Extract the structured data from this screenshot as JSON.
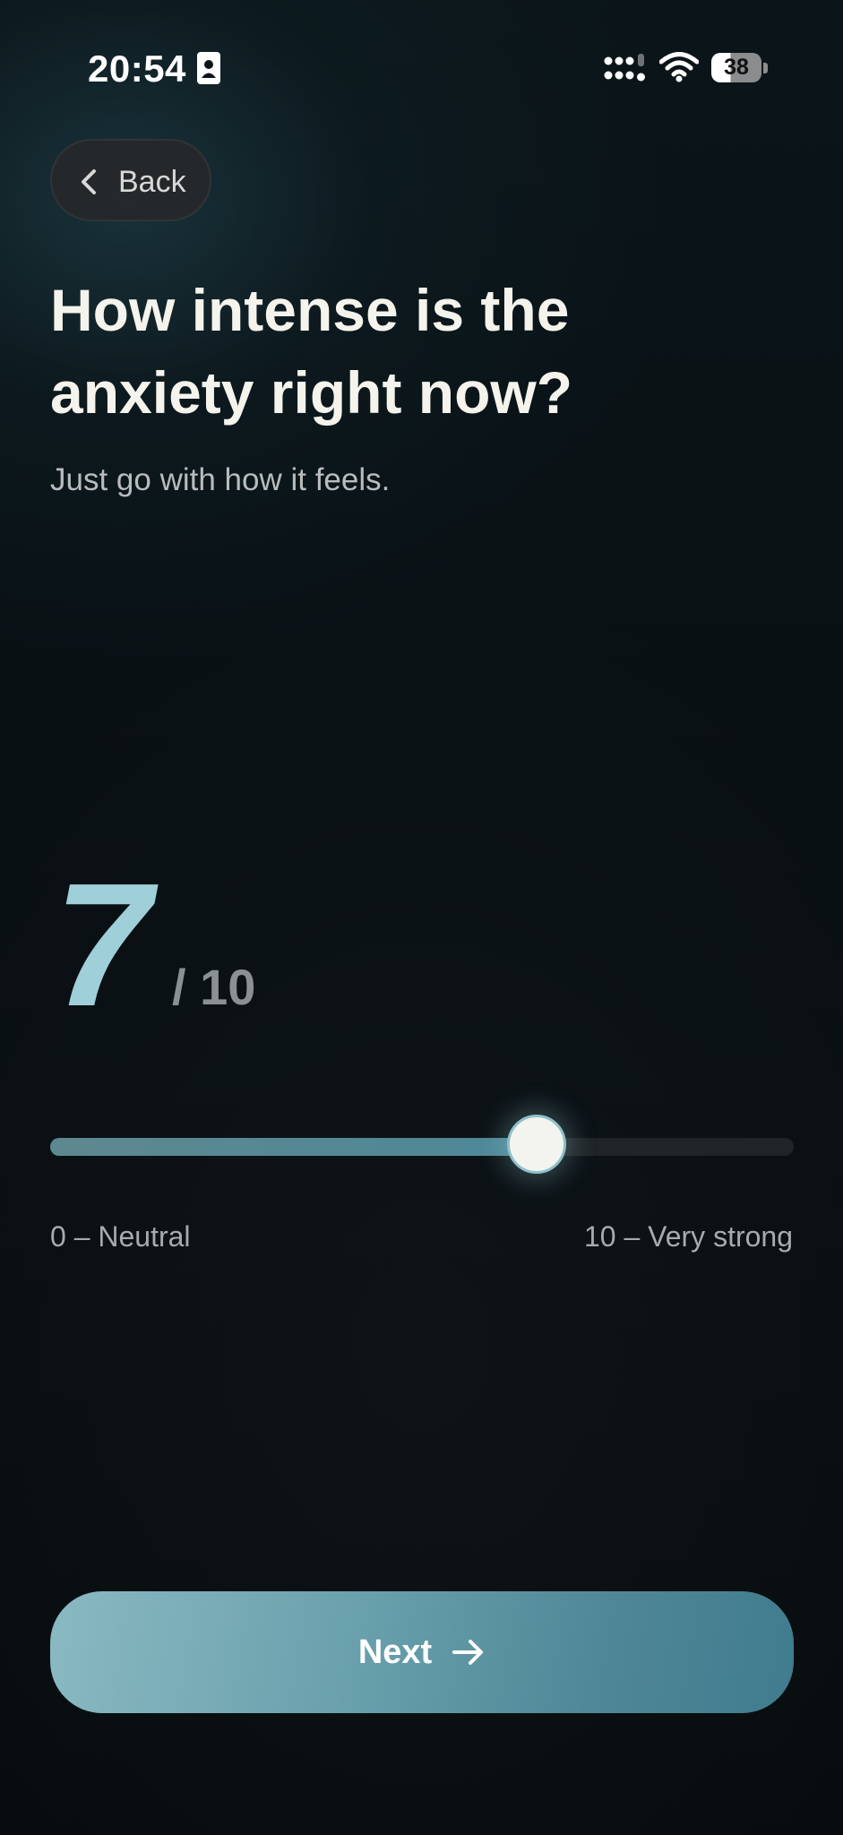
{
  "status_bar": {
    "time": "20:54",
    "battery_level": "38",
    "icons": [
      "sim-card-icon",
      "cellular-signal-icon",
      "wifi-icon",
      "battery-icon"
    ]
  },
  "header": {
    "back_label": "Back",
    "back_icon": "chevron-left-icon"
  },
  "question": {
    "title": "How intense is the anxiety right now?",
    "subtitle": "Just go with how it feels."
  },
  "intensity": {
    "value": "7",
    "max_label": "/ 10",
    "min": 0,
    "max": 10,
    "current": 7,
    "scale_min_label": "0 – Neutral",
    "scale_max_label": "10 – Very strong"
  },
  "footer": {
    "next_label": "Next",
    "next_icon": "arrow-right-icon"
  },
  "colors": {
    "accent": "#9fcfd9",
    "button_start": "#8ab9c2",
    "button_end": "#3f7c8e",
    "background": "#080c0e"
  }
}
